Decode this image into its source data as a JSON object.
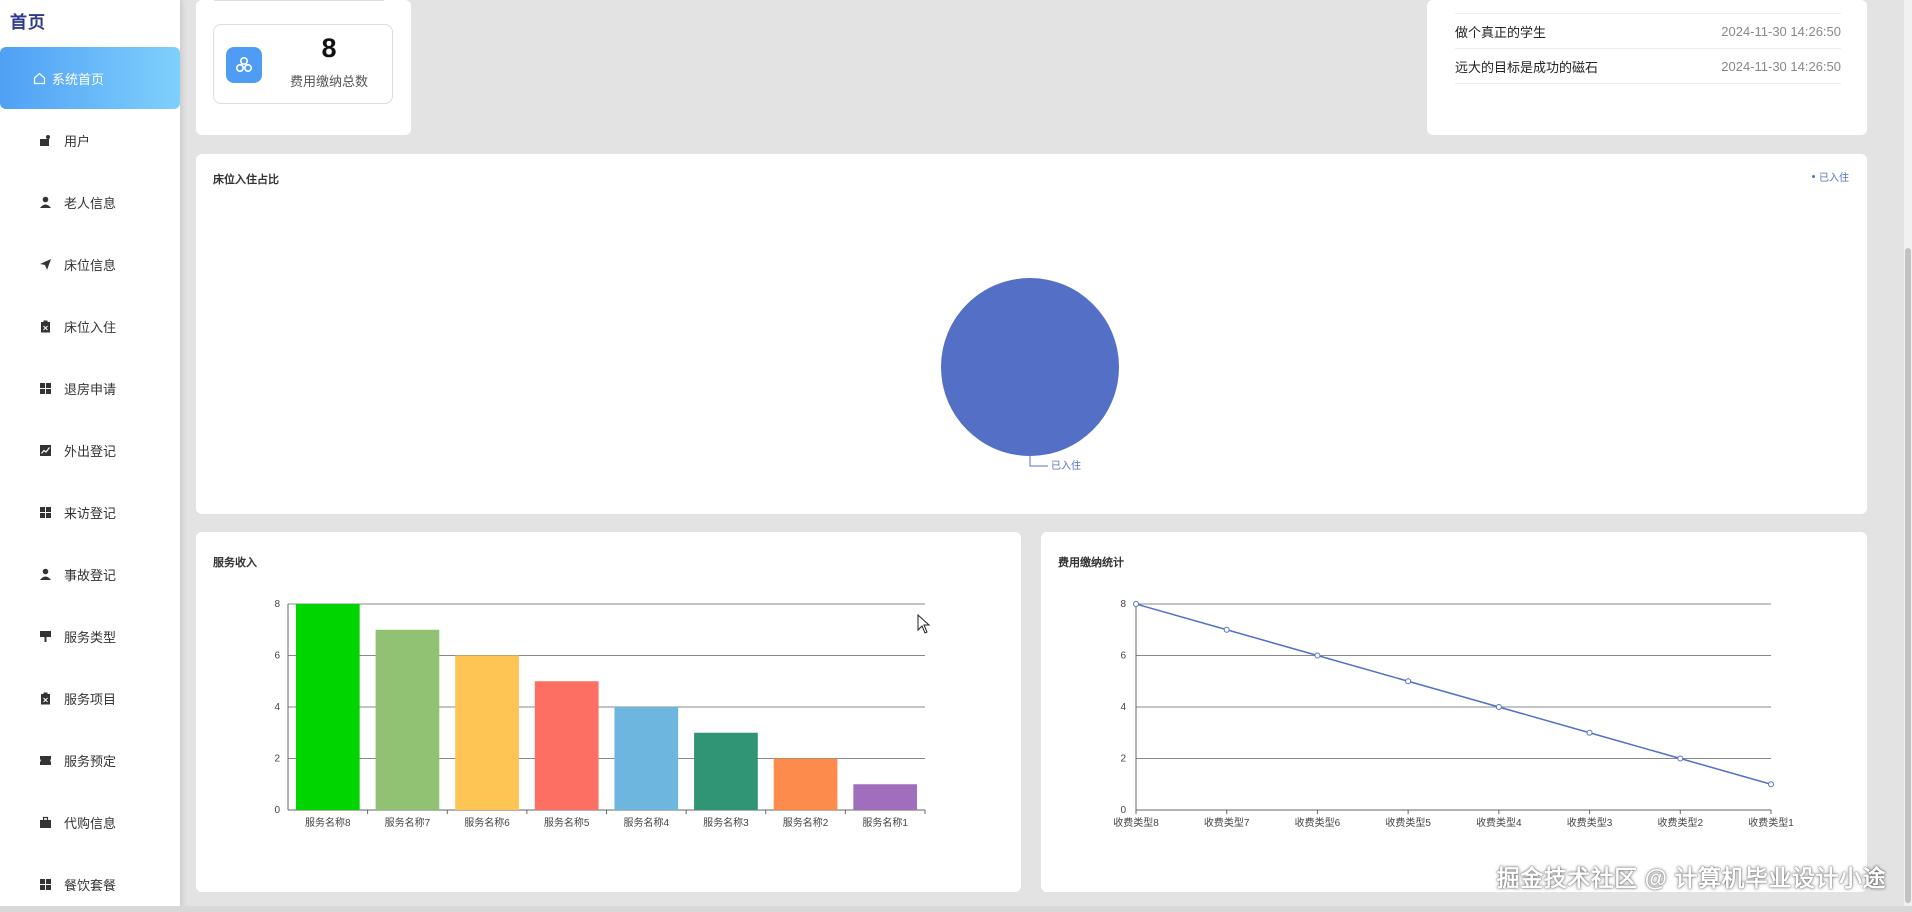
{
  "sidebar": {
    "logo": "首页",
    "items": [
      {
        "label": "系统首页",
        "icon": "home-icon",
        "active": true
      },
      {
        "label": "用户",
        "icon": "user-group-icon"
      },
      {
        "label": "老人信息",
        "icon": "person-icon"
      },
      {
        "label": "床位信息",
        "icon": "send-icon"
      },
      {
        "label": "床位入住",
        "icon": "clipboard-icon"
      },
      {
        "label": "退房申请",
        "icon": "grid-icon"
      },
      {
        "label": "外出登记",
        "icon": "chart-icon"
      },
      {
        "label": "来访登记",
        "icon": "grid-icon"
      },
      {
        "label": "事故登记",
        "icon": "person-icon"
      },
      {
        "label": "服务类型",
        "icon": "sign-icon"
      },
      {
        "label": "服务项目",
        "icon": "clipboard-icon"
      },
      {
        "label": "服务预定",
        "icon": "ticket-icon"
      },
      {
        "label": "代购信息",
        "icon": "briefcase-icon"
      },
      {
        "label": "餐饮套餐",
        "icon": "grid-icon"
      }
    ]
  },
  "stat": {
    "value": "8",
    "label": "费用缴纳总数"
  },
  "notices": [
    {
      "title": "做个真正的学生",
      "time": "2024-11-30 14:26:50"
    },
    {
      "title": "远大的目标是成功的磁石",
      "time": "2024-11-30 14:26:50"
    }
  ],
  "pie_card": {
    "title": "床位入住占比",
    "legend": "已入住",
    "slice_label": "已入住"
  },
  "bar_card": {
    "title": "服务收入"
  },
  "line_card": {
    "title": "费用缴纳统计"
  },
  "colors": {
    "accent": "#4fa0f5",
    "pie": "#5470c6",
    "line": "#5470c6"
  },
  "chart_data": [
    {
      "type": "pie",
      "title": "床位入住占比",
      "categories": [
        "已入住"
      ],
      "values": [
        1
      ],
      "legend": "top-right"
    },
    {
      "type": "bar",
      "title": "服务收入",
      "categories": [
        "服务名称8",
        "服务名称7",
        "服务名称6",
        "服务名称5",
        "服务名称4",
        "服务名称3",
        "服务名称2",
        "服务名称1"
      ],
      "values": [
        8,
        7,
        6,
        5,
        4,
        3,
        2,
        1
      ],
      "colors": [
        "#00d500",
        "#91c172",
        "#fec555",
        "#fd6f62",
        "#6cb6e0",
        "#2f9574",
        "#fd8b4b",
        "#a06ebd"
      ],
      "ylim": [
        0,
        8
      ],
      "yticks": [
        0,
        2,
        4,
        6,
        8
      ]
    },
    {
      "type": "line",
      "title": "费用缴纳统计",
      "categories": [
        "收费类型8",
        "收费类型7",
        "收费类型6",
        "收费类型5",
        "收费类型4",
        "收费类型3",
        "收费类型2",
        "收费类型1"
      ],
      "values": [
        8,
        7,
        6,
        5,
        4,
        3,
        2,
        1
      ],
      "ylim": [
        0,
        8
      ],
      "yticks": [
        0,
        2,
        4,
        6,
        8
      ]
    }
  ],
  "watermark": "掘金技术社区 @ 计算机毕业设计小途"
}
